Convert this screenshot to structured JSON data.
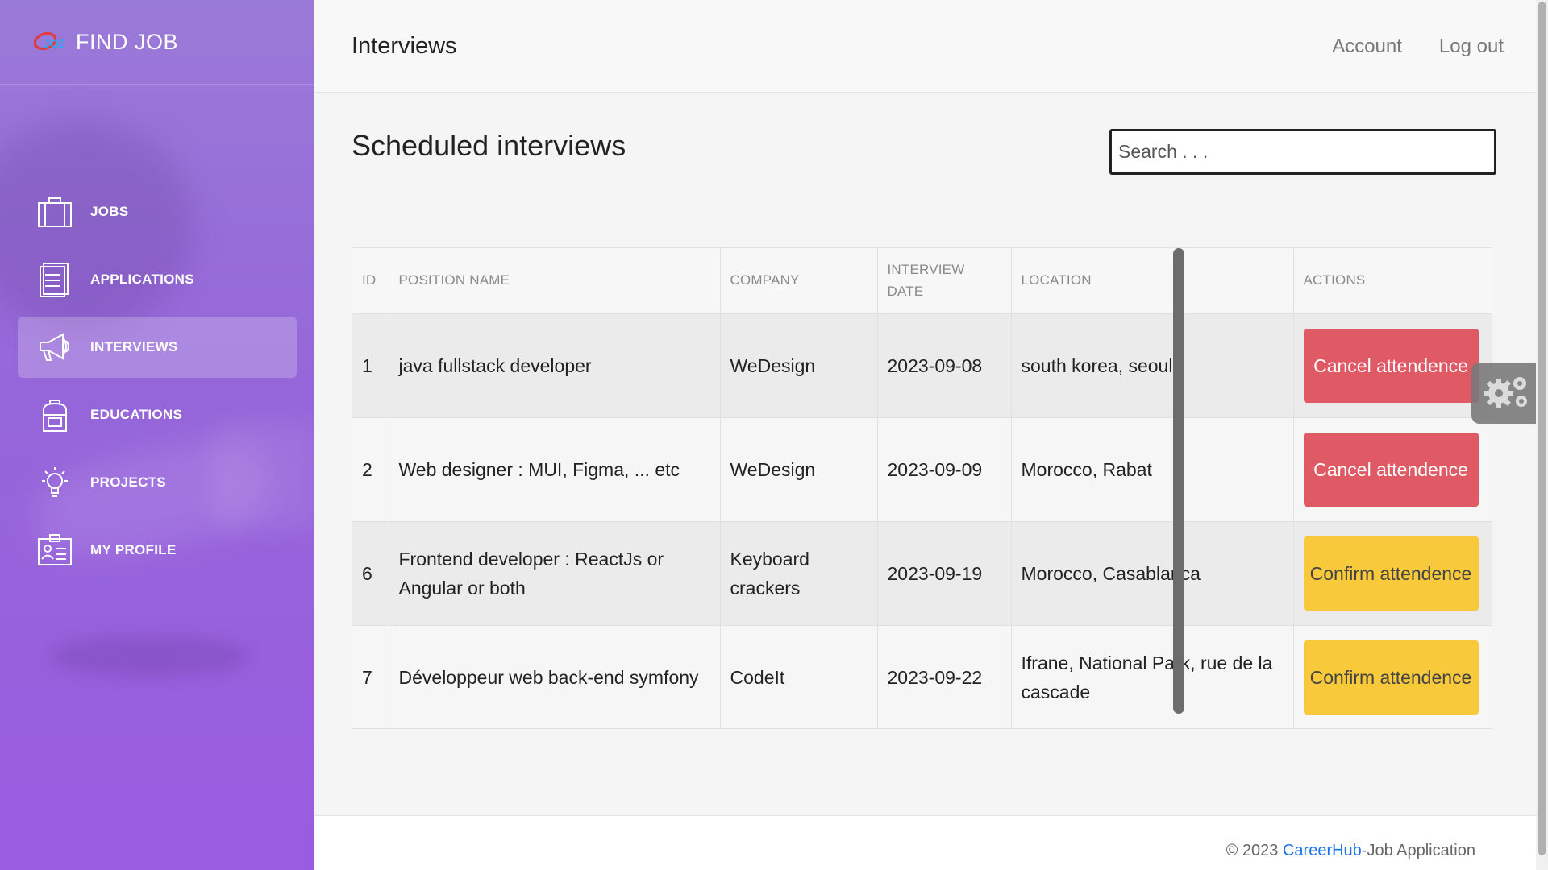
{
  "brand": {
    "name": "FIND JOB",
    "logo_text": "JOB"
  },
  "sidebar": {
    "items": [
      {
        "label": "JOBS",
        "icon": "briefcase-icon"
      },
      {
        "label": "APPLICATIONS",
        "icon": "document-icon"
      },
      {
        "label": "INTERVIEWS",
        "icon": "megaphone-icon",
        "active": true
      },
      {
        "label": "EDUCATIONS",
        "icon": "backpack-icon"
      },
      {
        "label": "PROJECTS",
        "icon": "lightbulb-icon"
      },
      {
        "label": "MY PROFILE",
        "icon": "id-card-icon"
      }
    ]
  },
  "header": {
    "title": "Interviews",
    "account_label": "Account",
    "logout_label": "Log out"
  },
  "main": {
    "section_title": "Scheduled interviews",
    "search_placeholder": "Search . . ."
  },
  "table": {
    "columns": [
      "ID",
      "POSITION NAME",
      "COMPANY",
      "INTERVIEW DATE",
      "LOCATION",
      "ACTIONS"
    ],
    "rows": [
      {
        "id": "1",
        "position": "java fullstack developer",
        "company": "WeDesign",
        "date": "2023-09-08",
        "location": "south korea, seoul",
        "action": "Cancel attendence",
        "action_type": "cancel"
      },
      {
        "id": "2",
        "position": "Web designer : MUI, Figma, ... etc",
        "company": "WeDesign",
        "date": "2023-09-09",
        "location": "Morocco, Rabat",
        "action": "Cancel attendence",
        "action_type": "cancel"
      },
      {
        "id": "6",
        "position": "Frontend developer : ReactJs or Angular or both",
        "company": "Keyboard crackers",
        "date": "2023-09-19",
        "location": "Morocco, Casablanca",
        "action": "Confirm attendence",
        "action_type": "confirm"
      },
      {
        "id": "7",
        "position": "Développeur web back-end symfony",
        "company": "CodeIt",
        "date": "2023-09-22",
        "location": "Ifrane, National Park, rue de la cascade",
        "action": "Confirm attendence",
        "action_type": "confirm"
      }
    ]
  },
  "footer": {
    "prefix": "© 2023 ",
    "brand_link": "CareerHub",
    "suffix": "-Job Application"
  },
  "colors": {
    "sidebar": "#9566d9",
    "cancel": "#e05a66",
    "confirm": "#f8c93a",
    "link": "#1a73e8"
  },
  "settings_icon": "gears-icon"
}
